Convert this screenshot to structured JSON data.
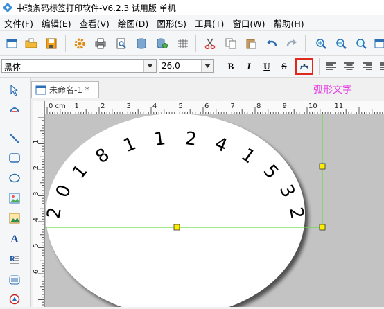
{
  "window": {
    "title": "中琅条码标签打印软件-V6.2.3 试用版 单机"
  },
  "menu": [
    {
      "label": "文件(F)"
    },
    {
      "label": "编辑(E)"
    },
    {
      "label": "查看(V)"
    },
    {
      "label": "绘图(D)"
    },
    {
      "label": "图形(S)"
    },
    {
      "label": "工具(T)"
    },
    {
      "label": "窗口(W)"
    },
    {
      "label": "帮助(H)"
    }
  ],
  "toolbar": {
    "icons": [
      "new-icon",
      "open-icon",
      "save-icon",
      "settings-icon",
      "print-icon",
      "print-preview-icon",
      "database-icon",
      "database-settings-icon",
      "grid-icon",
      "cut-icon",
      "copy-icon",
      "paste-icon",
      "undo-icon",
      "redo-icon",
      "zoom-in-icon",
      "zoom-out-icon",
      "zoom-fit-icon",
      "zoom-page-icon"
    ]
  },
  "format_bar": {
    "font_name": "黑体",
    "font_size": "26.0",
    "bold": "B",
    "italic": "I",
    "underline": "U",
    "strike": "S"
  },
  "document": {
    "tab_label": "未命名-1 *",
    "arc_text_label": "弧形文字"
  },
  "ruler": {
    "h_labels": [
      "0 cm",
      "1",
      "2",
      "3",
      "4",
      "5",
      "6",
      "7",
      "8",
      "9",
      "10",
      "11"
    ],
    "v_labels": [
      "1",
      "2",
      "3",
      "4",
      "5",
      "6"
    ]
  },
  "label_content": {
    "arc_chars": [
      "2",
      "0",
      "1",
      "8",
      "1",
      "1",
      "2",
      "4",
      "1",
      "5",
      "3",
      "2"
    ]
  },
  "colors": {
    "selection_line": "#66dd44",
    "handle": "#ffee00",
    "canvas": "#c3c3c3",
    "arc_label": "#e63ce6",
    "highlight_border": "#e0281f"
  }
}
